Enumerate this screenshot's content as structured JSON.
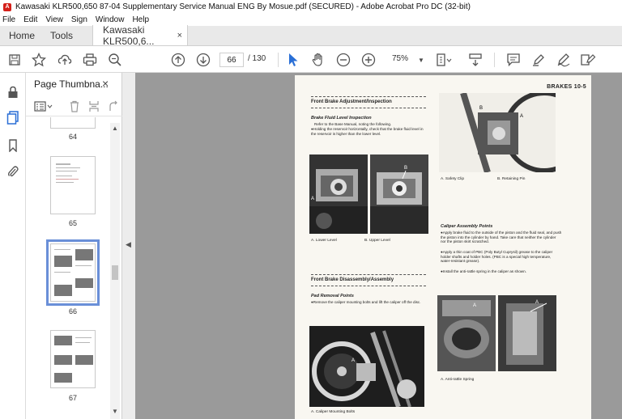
{
  "window": {
    "title": "Kawasaki KLR500,650 87-04 Supplementary Service Manual ENG By Mosue.pdf (SECURED) - Adobe Acrobat Pro DC (32-bit)",
    "app_icon": "acrobat-icon"
  },
  "menu": [
    "File",
    "Edit",
    "View",
    "Sign",
    "Window",
    "Help"
  ],
  "tabs": {
    "home": "Home",
    "tools": "Tools",
    "document": "Kawasaki KLR500,6...",
    "close": "×"
  },
  "toolbar": {
    "icons": [
      "save-icon",
      "bookmark-star-icon",
      "upload-cloud-icon",
      "print-icon",
      "zoom-search-icon",
      "prev-page-icon",
      "next-page-icon",
      "select-cursor-icon",
      "hand-icon",
      "zoom-out-icon",
      "zoom-in-icon",
      "fit-page-icon",
      "scroll-mode-icon",
      "comment-icon",
      "highlight-icon",
      "sign-icon",
      "fill-sign-icon"
    ],
    "current_page": "66",
    "total_pages": "/ 130",
    "zoom": "75%"
  },
  "thumbnails_panel": {
    "title": "Page Thumbna...",
    "close": "×",
    "pages": [
      {
        "label": "64",
        "selected": false
      },
      {
        "label": "65",
        "selected": false
      },
      {
        "label": "66",
        "selected": true
      },
      {
        "label": "67",
        "selected": false
      }
    ]
  },
  "document": {
    "header": "BRAKES  10-5",
    "section1": "Front Brake Adjustment/Inspection",
    "sub1": "Brake Fluid Level Inspection",
    "text1a": "Refer to the Base Manual, noting the following.",
    "text1b": "●Holding the reservoir horizontally, check that the brake fluid level in the reservoir is higher than the lower level.",
    "cap_a": "A. Lower Level",
    "cap_b": "B. Upper Level",
    "section2": "Front Brake Disassembly/Assembly",
    "sub2": "Pad Removal Points",
    "text2": "●Remove the caliper mounting bolts and lift the caliper off the disc.",
    "cap_caliper": "A. Caliper Mounting Bolts",
    "cap_safety_a": "A. Safety Clip",
    "cap_safety_b": "B. Retaining Pin",
    "sub3": "Caliper Assembly Points",
    "text3a": "●Apply brake fluid to the outside of the piston and the fluid seal, and push the piston into the cylinder by hand.  Take care that neither the cylinder nor the piston skirt scratched.",
    "text3b": "●Apply a thin coat of PBC (Poly Butyl Cuprysil) grease to the caliper holder shafts and holder holes.  (PBC is a special high temperature, water-resistant grease).",
    "text3c": "●Install the anti-rattle spring in the caliper as shown.",
    "cap_spring": "A. Anti-rattle Spring"
  }
}
